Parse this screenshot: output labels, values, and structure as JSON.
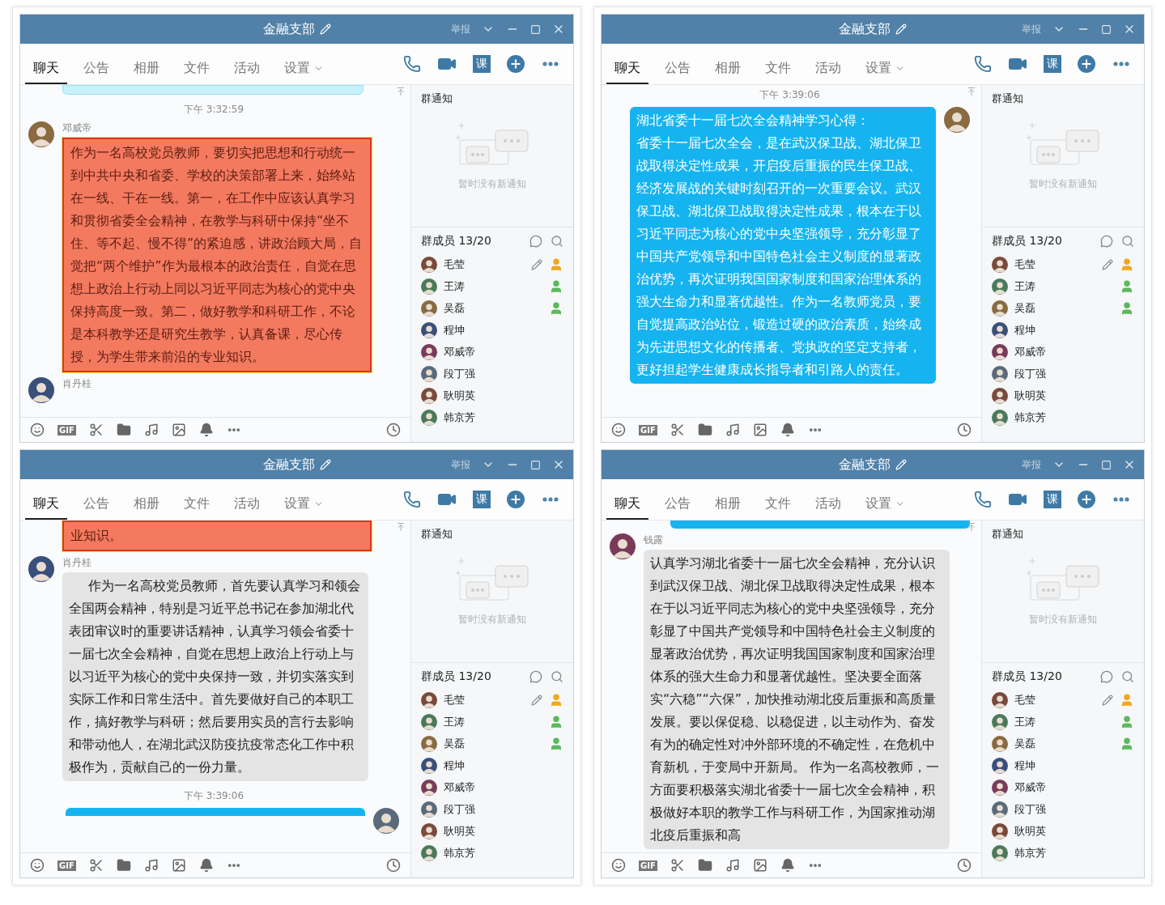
{
  "windows": [
    {
      "title": "金融支部",
      "report": "举报",
      "tabs": [
        {
          "label": "聊天",
          "selected": true
        },
        {
          "label": "公告",
          "selected": false
        },
        {
          "label": "相册",
          "selected": false
        },
        {
          "label": "文件",
          "selected": false
        },
        {
          "label": "活动",
          "selected": false
        },
        {
          "label": "设置",
          "selected": false,
          "dropdown": true
        }
      ],
      "course_tile": "课",
      "messages": [
        {
          "kind": "cyan",
          "mine": false
        },
        {
          "kind": "time",
          "text": "下午 3:32:59"
        },
        {
          "kind": "red",
          "mine": false,
          "avatar": true,
          "sender": "邓威帝",
          "text": "作为一名高校党员教师，要切实把思想和行动统一到中共中央和省委、学校的决策部署上来，始终站在一线、干在一线。第一，在工作中应该认真学习和贯彻省委全会精神，在教学与科研中保持“坐不住、等不起、慢不得”的紧迫感，讲政治顾大局，自觉把“两个维护”作为最根本的政治责任，自觉在思想上政治上行动上同以习近平同志为核心的党中央保持高度一致。第二，做好教学和科研工作，不论是本科教学还是研究生教学，认真备课，尽心传授，为学生带来前沿的专业知识。"
        },
        {
          "kind": "gray",
          "avatar": true,
          "sender": "肖丹桂"
        }
      ],
      "gif": "GIF",
      "notice_title": "群通知",
      "notice_empty": "暂时没有新通知",
      "members_title": "群成员 13/20",
      "members": [
        {
          "name": "毛莹",
          "owner": true,
          "admin": false,
          "editable": true
        },
        {
          "name": "王涛",
          "owner": false,
          "admin": true,
          "editable": false
        },
        {
          "name": "吴磊",
          "owner": false,
          "admin": true,
          "editable": false
        },
        {
          "name": "程坤",
          "owner": false,
          "admin": false,
          "editable": false
        },
        {
          "name": "邓威帝",
          "owner": false,
          "admin": false,
          "editable": false
        },
        {
          "name": "段丁强",
          "owner": false,
          "admin": false,
          "editable": false
        },
        {
          "name": "耿明英",
          "owner": false,
          "admin": false,
          "editable": false
        },
        {
          "name": "韩京芳",
          "owner": false,
          "admin": false,
          "editable": false
        }
      ]
    },
    {
      "title": "金融支部",
      "report": "举报",
      "tabs": [
        {
          "label": "聊天",
          "selected": true
        },
        {
          "label": "公告",
          "selected": false
        },
        {
          "label": "相册",
          "selected": false
        },
        {
          "label": "文件",
          "selected": false
        },
        {
          "label": "活动",
          "selected": false
        },
        {
          "label": "设置",
          "selected": false,
          "dropdown": true
        }
      ],
      "course_tile": "课",
      "messages": [
        {
          "kind": "time",
          "text": "下午 3:39:06"
        },
        {
          "kind": "blue",
          "mine": true,
          "avatar": true,
          "heading": "湖北省委十一届七次全会精神学习心得：",
          "text": "省委十一届七次全会，是在武汉保卫战、湖北保卫战取得决定性成果，开启疫后重振的民生保卫战、经济发展战的关键时刻召开的一次重要会议。武汉保卫战、湖北保卫战取得决定性成果，根本在于以习近平同志为核心的党中央坚强领导，充分彰显了中国共产党领导和中国特色社会主义制度的显著政治优势，再次证明我国国家制度和国家治理体系的强大生命力和显著优越性。作为一名教师党员，要自觉提高政治站位，锻造过硬的政治素质，始终成为先进思想文化的传播者、党执政的坚定支持者，更好担起学生健康成长指导者和引路人的责任。"
        }
      ],
      "gif": "GIF",
      "notice_title": "群通知",
      "notice_empty": "暂时没有新通知",
      "members_title": "群成员 13/20",
      "members": [
        {
          "name": "毛莹",
          "owner": true,
          "admin": false,
          "editable": true
        },
        {
          "name": "王涛",
          "owner": false,
          "admin": true,
          "editable": false
        },
        {
          "name": "吴磊",
          "owner": false,
          "admin": true,
          "editable": false
        },
        {
          "name": "程坤",
          "owner": false,
          "admin": false,
          "editable": false
        },
        {
          "name": "邓威帝",
          "owner": false,
          "admin": false,
          "editable": false
        },
        {
          "name": "段丁强",
          "owner": false,
          "admin": false,
          "editable": false
        },
        {
          "name": "耿明英",
          "owner": false,
          "admin": false,
          "editable": false
        },
        {
          "name": "韩京芳",
          "owner": false,
          "admin": false,
          "editable": false
        }
      ]
    },
    {
      "title": "金融支部",
      "report": "举报",
      "tabs": [
        {
          "label": "聊天",
          "selected": true
        },
        {
          "label": "公告",
          "selected": false
        },
        {
          "label": "相册",
          "selected": false
        },
        {
          "label": "文件",
          "selected": false
        },
        {
          "label": "活动",
          "selected": false
        },
        {
          "label": "设置",
          "selected": false,
          "dropdown": true
        }
      ],
      "course_tile": "课",
      "messages": [
        {
          "kind": "red",
          "avatar": false,
          "text": "业知识。"
        },
        {
          "kind": "gray",
          "mine": false,
          "avatar": true,
          "sender": "肖丹桂",
          "indented": true,
          "text": "作为一名高校党员教师，首先要认真学习和领会全国两会精神，特别是习近平总书记在参加湖北代表团审议时的重要讲话精神，认真学习领会省委十一届七次全会精神，自觉在思想上政治上行动上与以习近平为核心的党中央保持一致，并切实落实到实际工作和日常生活中。首先要做好自己的本职工作，搞好教学与科研；然后要用实员的言行去影响和带动他人，在湖北武汉防疫抗疫常态化工作中积极作为，贡献自己的一份力量。"
        },
        {
          "kind": "time",
          "text": "下午 3:39:06"
        },
        {
          "kind": "blue",
          "mine": true,
          "avatar": true
        }
      ],
      "gif": "GIF",
      "notice_title": "群通知",
      "notice_empty": "暂时没有新通知",
      "members_title": "群成员 13/20",
      "members": [
        {
          "name": "毛莹",
          "owner": true,
          "admin": false,
          "editable": true
        },
        {
          "name": "王涛",
          "owner": false,
          "admin": true,
          "editable": false
        },
        {
          "name": "吴磊",
          "owner": false,
          "admin": true,
          "editable": false
        },
        {
          "name": "程坤",
          "owner": false,
          "admin": false,
          "editable": false
        },
        {
          "name": "邓威帝",
          "owner": false,
          "admin": false,
          "editable": false
        },
        {
          "name": "段丁强",
          "owner": false,
          "admin": false,
          "editable": false
        },
        {
          "name": "耿明英",
          "owner": false,
          "admin": false,
          "editable": false
        },
        {
          "name": "韩京芳",
          "owner": false,
          "admin": false,
          "editable": false
        }
      ]
    },
    {
      "title": "金融支部",
      "report": "举报",
      "tabs": [
        {
          "label": "聊天",
          "selected": true
        },
        {
          "label": "公告",
          "selected": false
        },
        {
          "label": "相册",
          "selected": false
        },
        {
          "label": "文件",
          "selected": false
        },
        {
          "label": "活动",
          "selected": false
        },
        {
          "label": "设置",
          "selected": false,
          "dropdown": true
        }
      ],
      "course_tile": "课",
      "messages": [
        {
          "kind": "blue",
          "mine": true,
          "avatar": false
        },
        {
          "kind": "gray",
          "mine": false,
          "avatar": true,
          "sender": "钱露",
          "text": "认真学习湖北省委十一届七次全会精神，充分认识到武汉保卫战、湖北保卫战取得决定性成果，根本在于以习近平同志为核心的党中央坚强领导，充分彰显了中国共产党领导和中国特色社会主义制度的显著政治优势，再次证明我国国家制度和国家治理体系的强大生命力和显著优越性。坚决要全面落实“六稳”“六保”，加快推动湖北疫后重振和高质量发展。要以保促稳、以稳促进，以主动作为、奋发有为的确定性对冲外部环境的不确定性，在危机中育新机，于变局中开新局。 作为一名高校教师，一方面要积极落实湖北省委十一届七次全会精神，积极做好本职的教学工作与科研工作，为国家推动湖北疫后重振和高"
        }
      ],
      "gif": "GIF",
      "notice_title": "群通知",
      "notice_empty": "暂时没有新通知",
      "members_title": "群成员 13/20",
      "members": [
        {
          "name": "毛莹",
          "owner": true,
          "admin": false,
          "editable": true
        },
        {
          "name": "王涛",
          "owner": false,
          "admin": true,
          "editable": false
        },
        {
          "name": "吴磊",
          "owner": false,
          "admin": true,
          "editable": false
        },
        {
          "name": "程坤",
          "owner": false,
          "admin": false,
          "editable": false
        },
        {
          "name": "邓威帝",
          "owner": false,
          "admin": false,
          "editable": false
        },
        {
          "name": "段丁强",
          "owner": false,
          "admin": false,
          "editable": false
        },
        {
          "name": "耿明英",
          "owner": false,
          "admin": false,
          "editable": false
        },
        {
          "name": "韩京芳",
          "owner": false,
          "admin": false,
          "editable": false
        }
      ]
    }
  ]
}
